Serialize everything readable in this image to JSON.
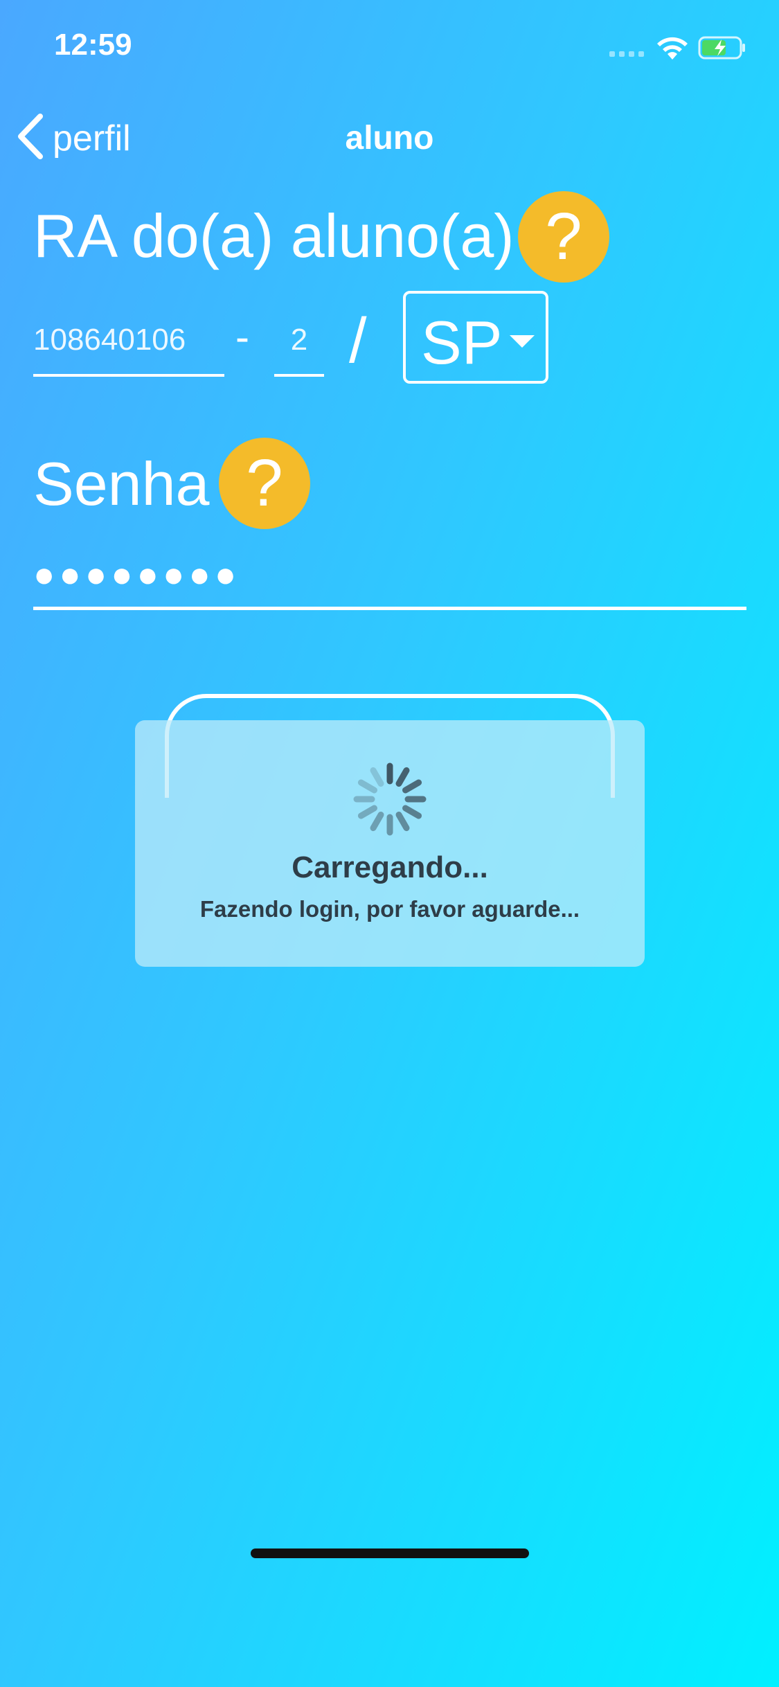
{
  "status_bar": {
    "time": "12:59"
  },
  "nav": {
    "back_label": "perfil",
    "title": "aluno"
  },
  "ra": {
    "title": "RA do(a) aluno(a)",
    "help": "?",
    "number": "108640106",
    "separator": "-",
    "digit": "2",
    "slash": "/",
    "state": "SP"
  },
  "senha": {
    "title": "Senha",
    "help": "?",
    "masked_value": "●●●●●●●●"
  },
  "loading": {
    "title": "Carregando...",
    "subtitle": "Fazendo login, por favor aguarde..."
  },
  "colors": {
    "help_badge": "#f4bb2a",
    "loading_text": "#2e3d48"
  }
}
